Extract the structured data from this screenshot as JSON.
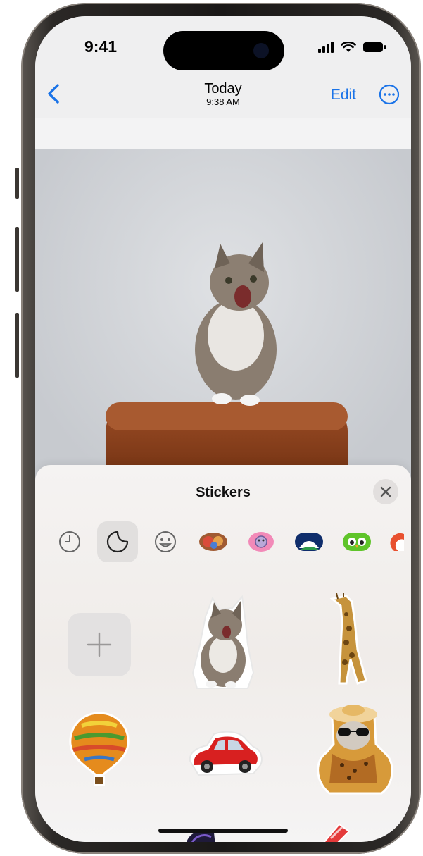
{
  "status": {
    "time": "9:41"
  },
  "nav": {
    "title": "Today",
    "subtitle": "9:38 AM",
    "edit_label": "Edit",
    "accent_color": "#1a73e8"
  },
  "sticker_panel": {
    "title": "Stickers",
    "tabs": [
      {
        "icon": "clock-icon",
        "selected": false
      },
      {
        "icon": "sticker-peel-icon",
        "selected": true
      },
      {
        "icon": "smiley-icon",
        "selected": false
      },
      {
        "icon": "memoji-sticker-pack-icon",
        "selected": false
      },
      {
        "icon": "pink-sticker-pack-icon",
        "selected": false
      },
      {
        "icon": "landscape-sticker-pack-icon",
        "selected": false
      },
      {
        "icon": "owl-sticker-pack-icon",
        "selected": false
      },
      {
        "icon": "partial-sticker-pack-icon",
        "selected": false
      }
    ],
    "stickers": [
      {
        "icon": "add-sticker-icon"
      },
      {
        "icon": "cat-sticker"
      },
      {
        "icon": "giraffe-sticker"
      },
      {
        "icon": "hot-air-balloon-sticker"
      },
      {
        "icon": "red-car-sticker"
      },
      {
        "icon": "cat-in-sunglasses-sticker"
      }
    ]
  }
}
